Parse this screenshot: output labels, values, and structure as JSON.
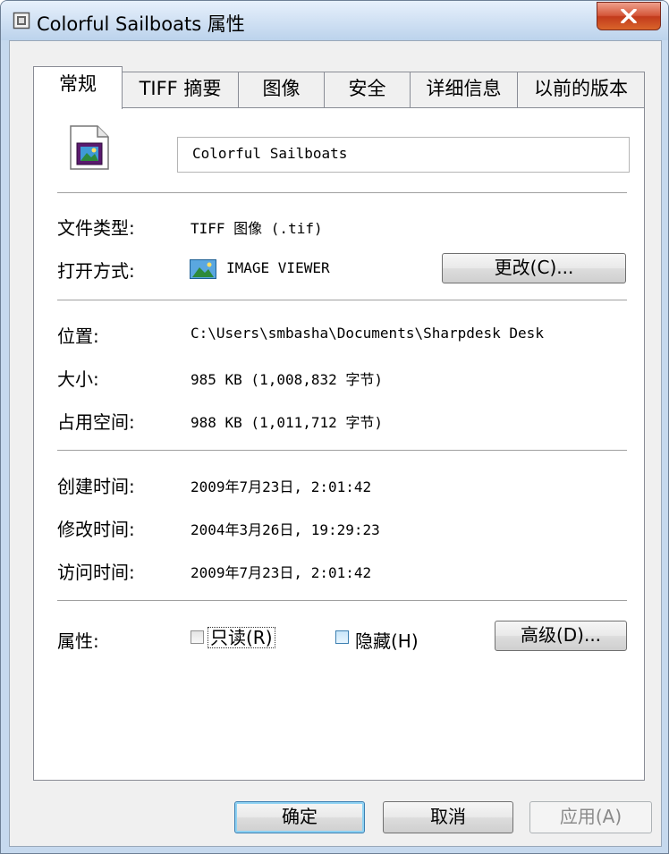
{
  "window": {
    "title": "Colorful Sailboats 属性",
    "close_label": "X"
  },
  "tabs": [
    {
      "label": "常规",
      "selected": true
    },
    {
      "label": "TIFF 摘要",
      "selected": false
    },
    {
      "label": "图像",
      "selected": false
    },
    {
      "label": "安全",
      "selected": false
    },
    {
      "label": "详细信息",
      "selected": false
    },
    {
      "label": "以前的版本",
      "selected": false
    }
  ],
  "general": {
    "file_name": "Colorful Sailboats",
    "file_type_label": "文件类型:",
    "file_type_value": "TIFF 图像 (.tif)",
    "opens_with_label": "打开方式:",
    "opens_with_value": "IMAGE VIEWER",
    "change_button": "更改(C)...",
    "location_label": "位置:",
    "location_value": "C:\\Users\\smbasha\\Documents\\Sharpdesk Desk",
    "size_label": "大小:",
    "size_value": "985 KB (1,008,832 字节)",
    "size_on_disk_label": "占用空间:",
    "size_on_disk_value": "988 KB (1,011,712 字节)",
    "created_label": "创建时间:",
    "created_value": "2009年7月23日, 2:01:42",
    "modified_label": "修改时间:",
    "modified_value": "2004年3月26日, 19:29:23",
    "accessed_label": "访问时间:",
    "accessed_value": "2009年7月23日, 2:01:42",
    "attributes_label": "属性:",
    "readonly_label": "只读(R)",
    "readonly_checked": false,
    "hidden_label": "隐藏(H)",
    "hidden_checked": false,
    "advanced_button": "高级(D)..."
  },
  "footer": {
    "ok": "确定",
    "cancel": "取消",
    "apply": "应用(A)"
  },
  "colors": {
    "accent": "#3c7fb1",
    "close": "#c23a1c",
    "title_bar": "#cfe0f3"
  }
}
